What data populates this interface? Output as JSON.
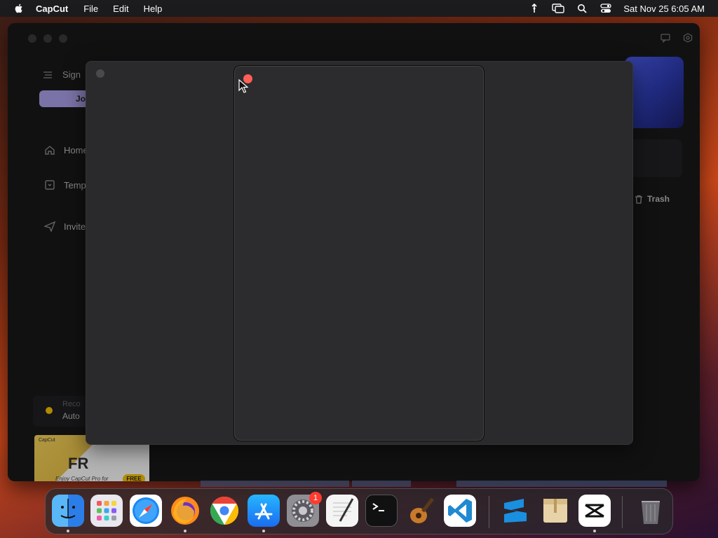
{
  "menubar": {
    "app_name": "CapCut",
    "items": [
      "File",
      "Edit",
      "Help"
    ],
    "clock": "Sat Nov 25  6:05 AM"
  },
  "app": {
    "sign_label": "Sign",
    "join_label": "Jo",
    "nav": [
      "Home",
      "Temp",
      "Invite"
    ],
    "rec_label_1": "Reco",
    "rec_label_2": "Auto",
    "trash_label": "Trash",
    "promo_brand": "CapCut",
    "promo_big": "FR",
    "promo_small": "Enjoy CapCut Pro for",
    "promo_free": "FREE"
  },
  "dock": {
    "apps": [
      {
        "name": "finder",
        "color": "#2b8cf0"
      },
      {
        "name": "launchpad",
        "color": "#e9e9ee"
      },
      {
        "name": "safari",
        "color": "#1f7cf0"
      },
      {
        "name": "firefox",
        "color": "#7a2fd0"
      },
      {
        "name": "chrome",
        "color": "#ffffff"
      },
      {
        "name": "app-store",
        "color": "#1a8cf5"
      },
      {
        "name": "system-settings",
        "color": "#8e8e93"
      },
      {
        "name": "textedit",
        "color": "#f4f4f4"
      },
      {
        "name": "terminal",
        "color": "#111111"
      },
      {
        "name": "garageband",
        "color": "#2a2a2a"
      },
      {
        "name": "vscode",
        "color": "#ffffff"
      },
      {
        "name": "sketchbook",
        "color": "#1a8fe0"
      },
      {
        "name": "archive-utility",
        "color": "#e8d3a8"
      },
      {
        "name": "capcut",
        "color": "#ffffff"
      },
      {
        "name": "trash",
        "color": "#555555"
      }
    ],
    "settings_badge": "1"
  }
}
